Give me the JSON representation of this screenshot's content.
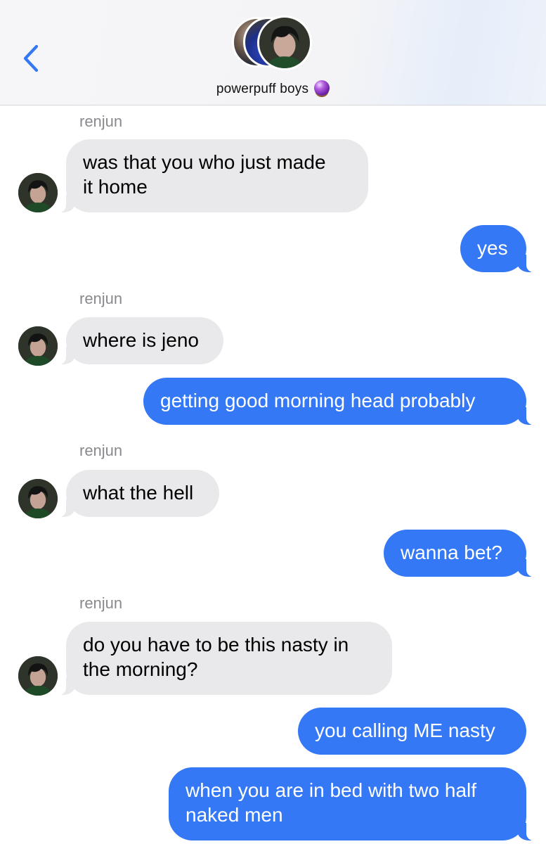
{
  "header": {
    "group_name": "powerpuff boys",
    "group_emoji_icon": "crystal-ball-icon",
    "back_icon": "chevron-left-icon"
  },
  "colors": {
    "accent": "#3478f6",
    "incoming_bubble": "#e9e9eb",
    "sender_label": "#8a8a8e"
  },
  "messages": [
    {
      "direction": "incoming",
      "sender": "renjun",
      "lines": [
        "was that you who just made",
        "it home"
      ]
    },
    {
      "direction": "outgoing",
      "lines": [
        "yes"
      ]
    },
    {
      "direction": "incoming",
      "sender": "renjun",
      "lines": [
        "where is jeno"
      ]
    },
    {
      "direction": "outgoing",
      "lines": [
        "getting good morning head probably"
      ]
    },
    {
      "direction": "incoming",
      "sender": "renjun",
      "lines": [
        "what the hell"
      ]
    },
    {
      "direction": "outgoing",
      "lines": [
        "wanna bet?"
      ]
    },
    {
      "direction": "incoming",
      "sender": "renjun",
      "lines": [
        "do you have to be this nasty in",
        "the morning?"
      ]
    },
    {
      "direction": "outgoing",
      "lines": [
        "you calling ME nasty"
      ]
    },
    {
      "direction": "outgoing",
      "lines": [
        "when you are in bed with two half",
        "naked men"
      ]
    }
  ]
}
